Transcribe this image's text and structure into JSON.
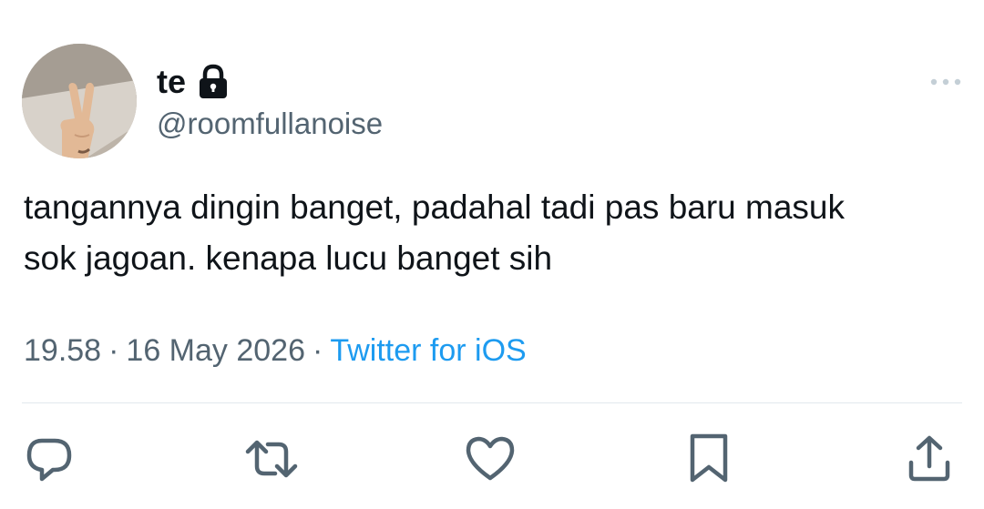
{
  "user": {
    "display_name": "te",
    "handle": "@roomfullanoise",
    "protected": true
  },
  "tweet": {
    "text": "tangannya dingin banget, padahal tadi pas baru masuk\nsok jagoan. kenapa lucu banget sih",
    "time": "19.58",
    "separator": "·",
    "date": "16 May 2026",
    "source": "Twitter for iOS"
  },
  "actions": {
    "reply_icon": "reply-icon",
    "retweet_icon": "retweet-icon",
    "like_icon": "heart-icon",
    "bookmark_icon": "bookmark-icon",
    "share_icon": "share-icon"
  },
  "colors": {
    "text": "#0f1419",
    "secondary": "#536471",
    "link": "#1d9bf0",
    "icon": "#536471"
  }
}
